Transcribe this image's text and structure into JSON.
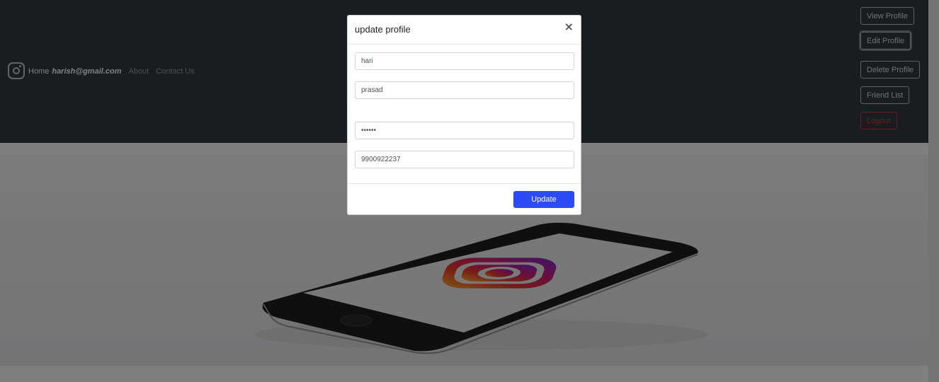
{
  "nav": {
    "home": "Home",
    "email": "harish@gmail.com",
    "about": "About",
    "contact": "Contact Us"
  },
  "side_buttons": {
    "view_profile": "View Profile",
    "edit_profile": "Edit Profile",
    "delete_profile": "Delete Profile",
    "friend_list": "Friend List",
    "logout": "Logout"
  },
  "carousel": {
    "prev_glyph": "‹",
    "next_glyph": "›"
  },
  "modal": {
    "title": "update profile",
    "close_glyph": "×",
    "fields": {
      "first_name": "hari",
      "last_name": "prasad",
      "password": "prasad",
      "phone": "9900922237"
    },
    "update_label": "Update"
  },
  "colors": {
    "navbar": "#343a40",
    "accent": "#2d4bf5",
    "danger": "#dc3545"
  }
}
